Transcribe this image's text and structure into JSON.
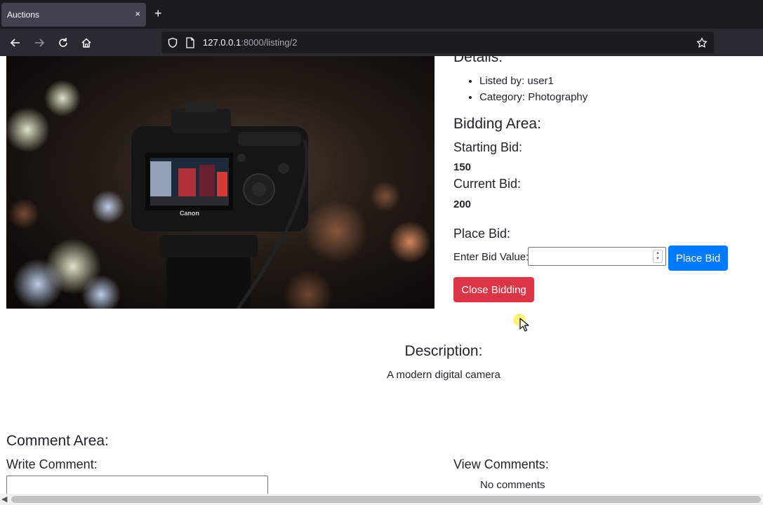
{
  "browser": {
    "tab_title": "Auctions",
    "tab_close": "×",
    "new_tab": "+",
    "url_host": "127.0.0.1",
    "url_path": ":8000/listing/2"
  },
  "listing": {
    "details_heading": "Details:",
    "details": [
      "Listed by: user1",
      "Category: Photography"
    ],
    "bidding_heading": "Bidding Area:",
    "starting_bid_label": "Starting Bid:",
    "starting_bid_value": "150",
    "current_bid_label": "Current Bid:",
    "current_bid_value": "200",
    "place_bid_heading": "Place Bid:",
    "bid_value_label": "Enter Bid Value:",
    "bid_input_value": "",
    "place_bid_button": "Place Bid",
    "close_bidding_button": "Close Bidding",
    "description_heading": "Description:",
    "description": "A modern digital camera",
    "image_brand_text": "Canon"
  },
  "comments": {
    "heading": "Comment Area:",
    "write_label": "Write Comment:",
    "comment_input_value": "",
    "view_label": "View Comments:",
    "empty_text": "No comments"
  },
  "colors": {
    "primary": "#007bff",
    "danger": "#dc3545",
    "chrome_dark": "#1c1b22",
    "chrome_toolbar": "#2b2a33"
  },
  "icons": [
    "back-arrow-icon",
    "forward-arrow-icon",
    "reload-icon",
    "home-icon",
    "shield-icon",
    "page-icon",
    "bookmark-star-icon",
    "cursor-icon",
    "spinner-icon",
    "scroll-left-arrow-icon"
  ]
}
